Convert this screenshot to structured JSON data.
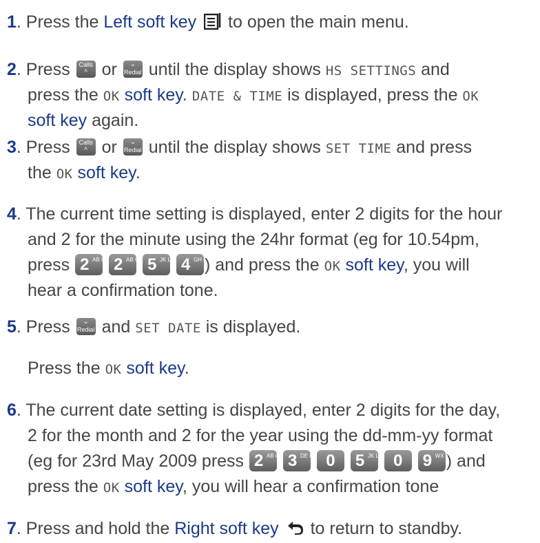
{
  "steps": [
    {
      "num": "1",
      "t": [
        ". Press the ",
        "Left soft key",
        " to open the main menu."
      ]
    },
    {
      "num": "2",
      "t": [
        ". Press ",
        " or ",
        " until the display shows ",
        "HS SETTINGS",
        " and",
        "press the ",
        "OK",
        " soft key",
        ". ",
        "DATE & TIME",
        " is displayed, press the ",
        "OK",
        "soft key",
        " again."
      ]
    },
    {
      "num": "3",
      "t": [
        ". Press ",
        " or ",
        " until the display shows ",
        "SET TIME",
        " and press",
        "the ",
        "OK",
        " soft key",
        "."
      ]
    },
    {
      "num": "4",
      "t": [
        ". The current time setting is displayed, enter 2 digits for the hour",
        "and 2 for the minute using the 24hr format (eg for 10.54pm,",
        "press ",
        ") and press the ",
        "OK",
        " soft key",
        ", you will",
        "hear a confirmation tone."
      ]
    },
    {
      "num": "5",
      "t": [
        ". Press ",
        " and ",
        "SET DATE",
        " is displayed.",
        "Press the ",
        "OK",
        " soft key",
        "."
      ]
    },
    {
      "num": "6",
      "t": [
        ". The current date setting is displayed, enter 2 digits for the day,",
        "2 for the month and 2 for the year using the dd-mm-yy format",
        "(eg for 23rd May 2009 press ",
        ") and",
        "press the ",
        "OK",
        " soft key",
        ", you will hear a confirmation tone"
      ]
    },
    {
      "num": "7",
      "t": [
        ". Press and hold the ",
        "Right soft key",
        " to return to standby."
      ]
    }
  ],
  "keys": {
    "calls": "Calls",
    "redial": "Redial",
    "up_chevron": "^",
    "down_chevron": "⌄"
  },
  "keypad": {
    "time": [
      {
        "d": "2",
        "s": "AB C"
      },
      {
        "d": "2",
        "s": "AB C"
      },
      {
        "d": "5",
        "s": "JK L"
      },
      {
        "d": "4",
        "s": "GH I"
      }
    ],
    "date": [
      {
        "d": "2",
        "s": "AB C"
      },
      {
        "d": "3",
        "s": "DE F"
      },
      {
        "d": "0",
        "s": ""
      },
      {
        "d": "5",
        "s": "JK L"
      },
      {
        "d": "0",
        "s": ""
      },
      {
        "d": "9",
        "s": "WX YZ"
      }
    ]
  },
  "icons": {
    "left_soft_key": "menu-icon",
    "right_soft_key": "back-arrow-icon"
  },
  "colors": {
    "text": "#454545",
    "accent_blue": "#1a3a8a",
    "key_gray": "#6e6e6e"
  }
}
